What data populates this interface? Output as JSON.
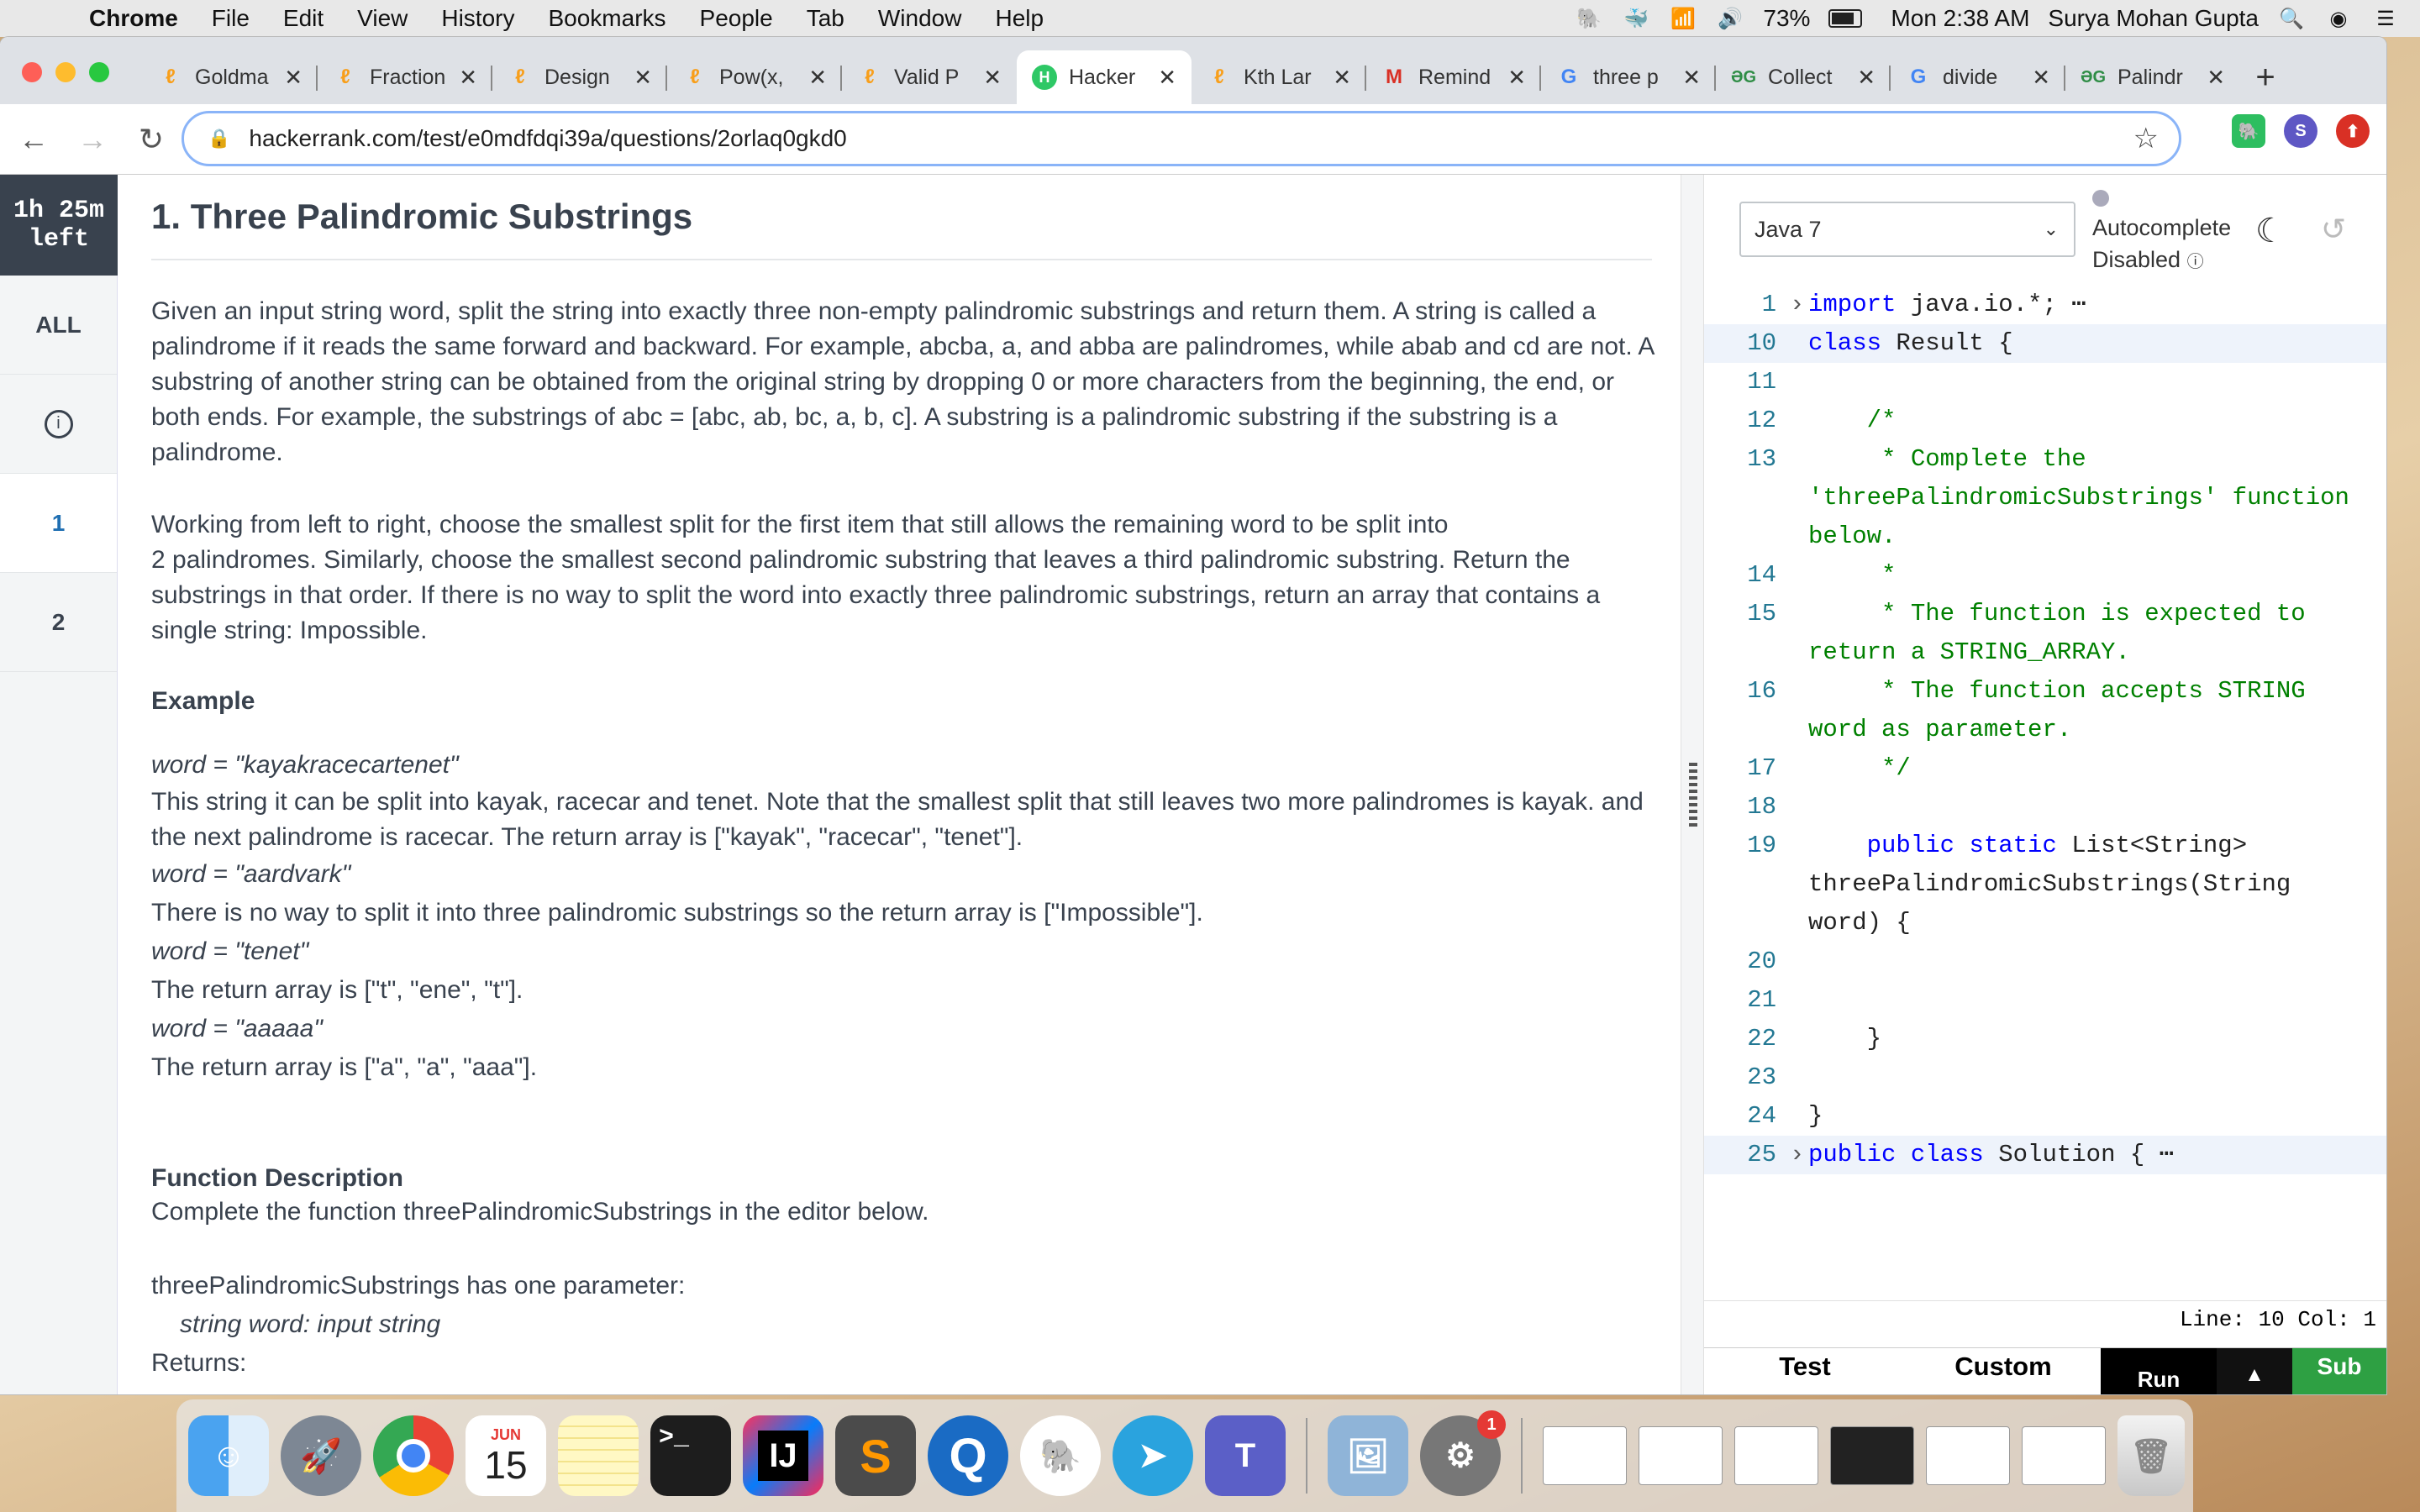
{
  "menubar": {
    "app": "Chrome",
    "items": [
      "File",
      "Edit",
      "View",
      "History",
      "Bookmarks",
      "People",
      "Tab",
      "Window",
      "Help"
    ],
    "battery": "73%",
    "clock": "Mon 2:38 AM",
    "user": "Surya Mohan Gupta"
  },
  "tabs": [
    {
      "title": "Goldma",
      "icon": "leetcode-icon"
    },
    {
      "title": "Fraction",
      "icon": "leetcode-icon"
    },
    {
      "title": "Design",
      "icon": "leetcode-icon"
    },
    {
      "title": "Pow(x,",
      "icon": "leetcode-icon"
    },
    {
      "title": "Valid P",
      "icon": "leetcode-icon"
    },
    {
      "title": "Hacker",
      "icon": "hackerrank-icon"
    },
    {
      "title": "Kth Lar",
      "icon": "leetcode-icon"
    },
    {
      "title": "Remind",
      "icon": "gmail-icon"
    },
    {
      "title": "three p",
      "icon": "google-icon"
    },
    {
      "title": "Collect",
      "icon": "geeksforgeeks-icon"
    },
    {
      "title": "divide",
      "icon": "google-icon"
    },
    {
      "title": "Palindr",
      "icon": "geeksforgeeks-icon"
    }
  ],
  "address": "hackerrank.com/test/e0mdfdqi39a/questions/2orlaq0gkd0",
  "profile_initial": "S",
  "sidebar": {
    "timer_line1": "1h 25m",
    "timer_line2": "left",
    "all": "ALL",
    "q1": "1",
    "q2": "2"
  },
  "problem": {
    "title": "1. Three Palindromic Substrings",
    "p1": "Given an input string word, split the string into exactly three non-empty palindromic substrings and return them. A string is called a palindrome if it reads the same forward and backward. For example, abcba, a, and abba are palindromes, while abab and cd are not. A substring of another string can be obtained from the original string by dropping 0 or more characters from the beginning, the end, or both ends. For example, the substrings of abc = [abc, ab, bc, a, b, c]. A substring is a palindromic substring if the substring is a palindrome.",
    "p2a": "Working from left to right, choose the smallest split for the first item that still allows the remaining word to be split into",
    "p2b": "2 palindromes. Similarly, choose the smallest second palindromic substring that leaves a third palindromic substring. Return the substrings in that order. If there is no way to split the word into exactly three palindromic substrings, return an array that contains a single string: Impossible.",
    "example_heading": "Example",
    "ex1_word": "word = \"kayakracecartenet\"",
    "ex1_text": "This string it can be split into kayak, racecar and tenet. Note that the smallest split that still leaves two more palindromes is kayak. and the next palindrome is racecar. The return array is [\"kayak\", \"racecar\", \"tenet\"].",
    "ex2_word": "word = \"aardvark\"",
    "ex2_text": "There is no way to split it into three palindromic substrings so the return array is [\"Impossible\"].",
    "ex3_word": "word = \"tenet\"",
    "ex3_text": "The return array is [\"t\", \"ene\", \"t\"].",
    "ex4_word": "word = \"aaaaa\"",
    "ex4_text": "The return array is [\"a\", \"a\", \"aaa\"].",
    "fd_heading": "Function Description",
    "fd_text": "Complete the function threePalindromicSubstrings in the editor below.",
    "fd_param_intro": "threePalindromicSubstrings has one parameter:",
    "fd_param": "string word:  input string",
    "returns": "Returns:"
  },
  "editor": {
    "language": "Java 7",
    "autocomplete_line1": "Autocomplete",
    "autocomplete_line2": "Disabled",
    "status": "Line: 10 Col: 1",
    "test_tab": "Test",
    "custom_tab": "Custom",
    "run_button": "Run",
    "submit_button": "Sub",
    "lines": [
      {
        "n": "1",
        "fold": true,
        "text": "import java.io.*; ⋯",
        "cls": "kwline"
      },
      {
        "n": "10",
        "text": "class Result {",
        "hl": true
      },
      {
        "n": "11",
        "text": ""
      },
      {
        "n": "12",
        "text": "    /*",
        "cm": true
      },
      {
        "n": "13",
        "text": "     * Complete the 'threePalindromicSubstrings' function below.",
        "cm": true
      },
      {
        "n": "14",
        "text": "     *",
        "cm": true
      },
      {
        "n": "15",
        "text": "     * The function is expected to return a STRING_ARRAY.",
        "cm": true
      },
      {
        "n": "16",
        "text": "     * The function accepts STRING word as parameter.",
        "cm": true
      },
      {
        "n": "17",
        "text": "     */",
        "cm": true
      },
      {
        "n": "18",
        "text": ""
      },
      {
        "n": "19",
        "text": "    public static List<String> threePalindromicSubstrings(String word) {"
      },
      {
        "n": "20",
        "text": ""
      },
      {
        "n": "21",
        "text": ""
      },
      {
        "n": "22",
        "text": "    }"
      },
      {
        "n": "23",
        "text": ""
      },
      {
        "n": "24",
        "text": "}"
      },
      {
        "n": "25",
        "fold": true,
        "text": "public class Solution { ⋯"
      }
    ]
  },
  "dock": {
    "calendar_month": "JUN",
    "calendar_day": "15",
    "badge": "1"
  },
  "colors": {
    "hackerrank_green": "#2ec866",
    "timer_bg": "#39424e",
    "keyword": "#0000ff",
    "comment": "#008000"
  }
}
